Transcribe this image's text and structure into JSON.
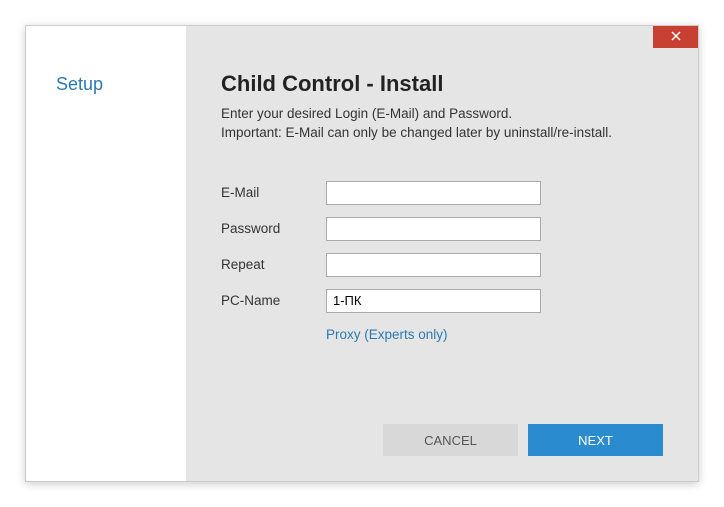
{
  "sidebar": {
    "title": "Setup"
  },
  "main": {
    "heading": "Child Control - Install",
    "desc_line1": "Enter your desired Login (E-Mail) and Password.",
    "desc_line2": "Important: E-Mail can only be changed later by uninstall/re-install."
  },
  "form": {
    "email_label": "E-Mail",
    "email_value": "",
    "password_label": "Password",
    "password_value": "",
    "repeat_label": "Repeat",
    "repeat_value": "",
    "pcname_label": "PC-Name",
    "pcname_value": "1-ПК",
    "proxy_link": "Proxy (Experts only)"
  },
  "buttons": {
    "cancel": "CANCEL",
    "next": "NEXT"
  },
  "colors": {
    "accent": "#2a8ccf",
    "link": "#2a7ab0",
    "close": "#c84031",
    "panel": "#e5e5e5"
  }
}
